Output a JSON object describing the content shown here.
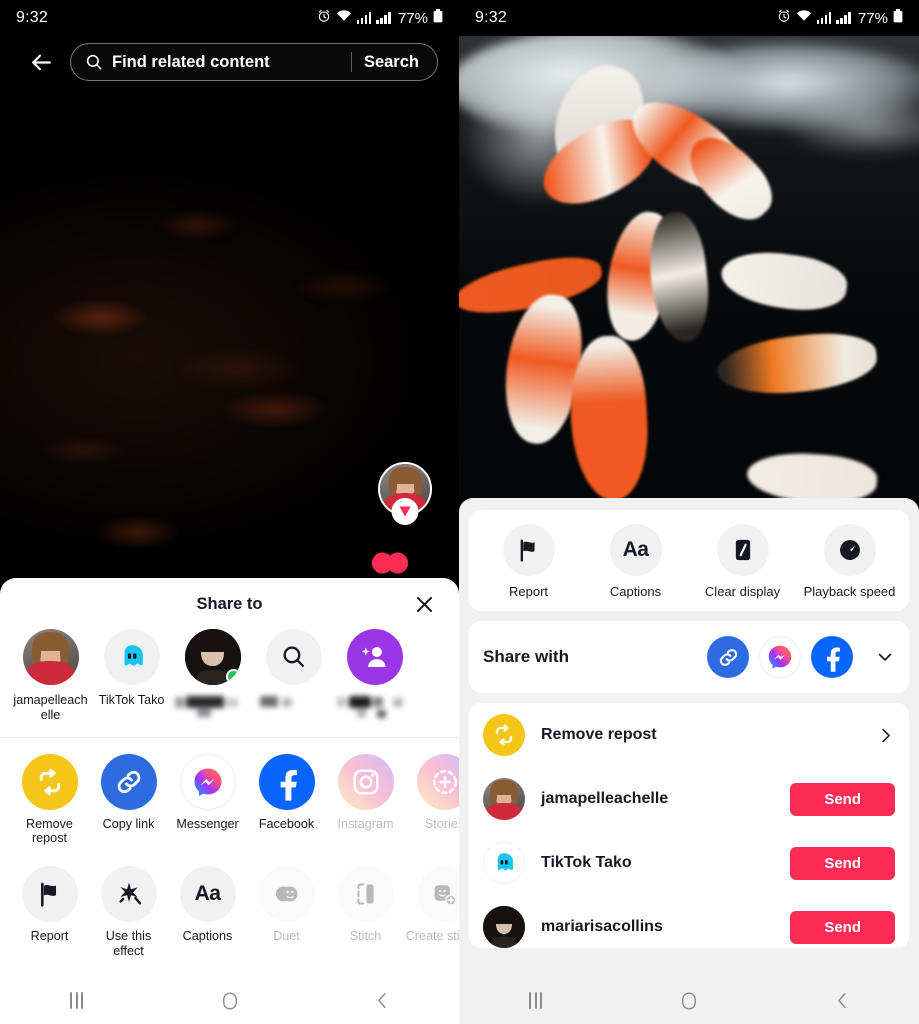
{
  "status_bar": {
    "time": "9:32",
    "battery_percent": "77%",
    "icons": [
      "alarm-icon",
      "wifi-icon",
      "signal-icon",
      "signal-icon",
      "battery-icon"
    ]
  },
  "left_panel": {
    "search": {
      "back_icon": "back-arrow-icon",
      "search_icon": "search-icon",
      "value": "Find related content",
      "placeholder": "Find related content",
      "button_label": "Search"
    },
    "video": {
      "avatar_name": "creator-avatar",
      "badge_icon": "repost-arrow-icon",
      "like_icon": "heart-icon"
    },
    "sheet": {
      "title": "Share to",
      "close_icon": "close-icon",
      "friends": [
        {
          "name": "jamapelleachelle",
          "icon": "user-avatar",
          "blurred": false,
          "online": false
        },
        {
          "name": "TikTok Tako",
          "icon": "tiktok-tako-icon",
          "blurred": false,
          "online": false
        },
        {
          "name": "",
          "icon": "user-avatar",
          "blurred": true,
          "online": true
        },
        {
          "name": "",
          "icon": "search-icon",
          "blurred": true,
          "online": false
        },
        {
          "name": "",
          "icon": "add-friend-icon",
          "blurred": true,
          "online": false
        }
      ],
      "row1": [
        {
          "label": "Remove repost",
          "icon": "repost-icon",
          "color": "#F5C518",
          "dim": false
        },
        {
          "label": "Copy link",
          "icon": "link-icon",
          "color": "#2D6CE0",
          "dim": false
        },
        {
          "label": "Messenger",
          "icon": "messenger-icon",
          "color": "#FFFFFF",
          "dim": false
        },
        {
          "label": "Facebook",
          "icon": "facebook-icon",
          "color": "#0866FF",
          "dim": false
        },
        {
          "label": "Instagram",
          "icon": "instagram-icon",
          "color": "#E1306C",
          "dim": true
        },
        {
          "label": "Stories",
          "icon": "stories-icon",
          "color": "#E1306C",
          "dim": true
        }
      ],
      "row2": [
        {
          "label": "Report",
          "icon": "flag-icon",
          "dim": false
        },
        {
          "label": "Use this effect",
          "icon": "effect-sparkle-icon",
          "dim": false
        },
        {
          "label": "Captions",
          "icon": "captions-aa-icon",
          "dim": false
        },
        {
          "label": "Duet",
          "icon": "duet-icon",
          "dim": true
        },
        {
          "label": "Stitch",
          "icon": "stitch-icon",
          "dim": true
        },
        {
          "label": "Create sticker",
          "icon": "create-sticker-icon",
          "dim": true
        }
      ]
    }
  },
  "right_panel": {
    "actions": [
      {
        "label": "Report",
        "icon": "flag-icon"
      },
      {
        "label": "Captions",
        "icon": "captions-aa-icon"
      },
      {
        "label": "Clear display",
        "icon": "clear-display-icon"
      },
      {
        "label": "Playback speed",
        "icon": "speedometer-icon"
      }
    ],
    "share_with": {
      "label": "Share with",
      "icons": [
        {
          "name": "link-icon",
          "color": "#2D6CE0"
        },
        {
          "name": "messenger-icon",
          "color": "#FFFFFF"
        },
        {
          "name": "facebook-icon",
          "color": "#0866FF"
        }
      ],
      "expand_icon": "chevron-down-icon"
    },
    "list": [
      {
        "type": "action",
        "label": "Remove repost",
        "icon": "repost-icon",
        "chevron": "chevron-right-icon"
      },
      {
        "type": "contact",
        "label": "jamapelleachelle",
        "icon": "user-avatar",
        "button": "Send"
      },
      {
        "type": "contact",
        "label": "TikTok Tako",
        "icon": "tiktok-tako-icon",
        "button": "Send"
      },
      {
        "type": "contact",
        "label": "mariarisacollins",
        "icon": "user-avatar",
        "button": "Send"
      }
    ]
  },
  "nav_bar": {
    "recents_icon": "recents-icon",
    "home_icon": "home-icon",
    "back_icon": "back-chevron-icon"
  },
  "colors": {
    "accent": "#FE2C55",
    "repost_yellow": "#F5C518",
    "facebook_blue": "#0866FF",
    "link_blue": "#2D6CE0",
    "online_green": "#22C55E",
    "sheet_bg": "#F1F1F2",
    "text": "#161823"
  }
}
